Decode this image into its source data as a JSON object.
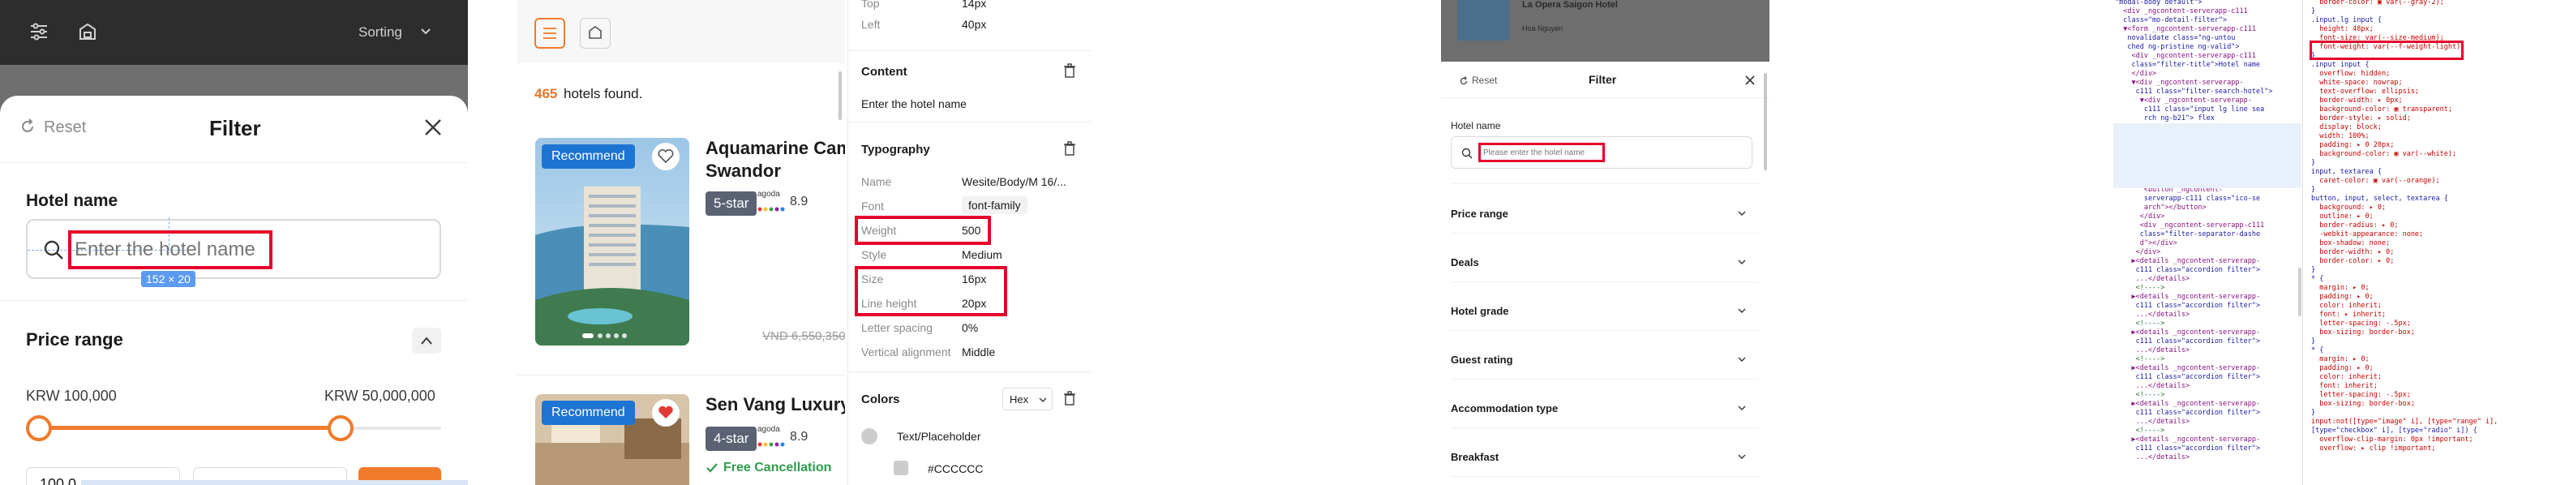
{
  "panel1": {
    "sorting_label": "Sorting",
    "reset_label": "Reset",
    "title": "Filter",
    "hotel_name_label": "Hotel name",
    "hotel_name_placeholder": "Enter the hotel name",
    "dimension_tag": "152 × 20",
    "price_range_label": "Price range",
    "price_min": "KRW 100,000",
    "price_max": "KRW 50,000,000",
    "min_input_partial": "100,0"
  },
  "panel2": {
    "count": "465",
    "count_suffix": "hotels found.",
    "hotels": [
      {
        "badge": "Recommend",
        "name_line1": "Aquamarine Cam",
        "name_line2": "Swandor",
        "stars": "5-star",
        "agoda": "agoda",
        "rating": "8.9",
        "old_price": "VND 6,550,350",
        "new_price_partial": "VI",
        "favorited": false
      },
      {
        "badge": "Recommend",
        "name_line1": "Sen Vang Luxury I",
        "stars": "4-star",
        "agoda": "agoda",
        "rating": "8.9",
        "cancellation": "Free Cancellation",
        "favorited": true
      }
    ]
  },
  "panel3": {
    "top_label": "Top",
    "top_value": "14px",
    "left_label": "Left",
    "left_value": "40px",
    "content_header": "Content",
    "content_text": "Enter the hotel name",
    "typography_header": "Typography",
    "rows": [
      {
        "label": "Name",
        "value": "Wesite/Body/M 16/..."
      },
      {
        "label": "Font",
        "value": "font-family"
      },
      {
        "label": "Weight",
        "value": "500"
      },
      {
        "label": "Style",
        "value": "Medium"
      },
      {
        "label": "Size",
        "value": "16px"
      },
      {
        "label": "Line height",
        "value": "20px"
      },
      {
        "label": "Letter spacing",
        "value": "0%"
      },
      {
        "label": "Vertical alignment",
        "value": "Middle"
      }
    ],
    "colors_header": "Colors",
    "color_format": "Hex",
    "color_token": "Text/Placeholder",
    "color_hex": "#CCCCCC"
  },
  "panel4": {
    "card_title_partial": "La Opera Saigon Hotel",
    "card_sub": "Hoa Nguyen",
    "reset_label": "Reset",
    "title": "Filter",
    "hotel_name_label": "Hotel name",
    "hotel_name_placeholder": "Please enter the hotel name",
    "accordions": [
      "Price range",
      "Deals",
      "Hotel grade",
      "Guest rating",
      "Accommodation type",
      "Breakfast"
    ]
  },
  "panel5": {
    "lines_left": [
      "\"modal-body default\">",
      "  <div _ngcontent-serverapp-c111",
      "  class=\"mo-detail-filter\">",
      "  ▼<form _ngcontent-serverapp-c111",
      "   novalidate class=\"ng-untou",
      "   ched ng-pristine ng-valid\">",
      "    <div _ngcontent-serverapp-c111",
      "    class=\"filter-title\">Hotel name",
      "    </div>",
      "    ▼<div _ngcontent-serverapp-",
      "     c111 class=\"filter-search-hotel\">",
      "      ▼<div _ngcontent-serverapp-",
      "       c111 class=\"input lg line sea",
      "       rch ng-b21\"> flex",
      "       <input _ngcontent-serverapp-",
      "       c111 type=\"text\"",
      "       autocomplete=\"off\"",
      "       placeholder=\"Please enter th",
      "       e hotel name\" class=\"ng-unto",
      "       uched ng-pristine ng-vali",
      "       d\"> == $0",
      "       <button _ngcontent-",
      "       serverapp-c111 class=\"ico-se",
      "       arch\"></button>",
      "      </div>",
      "      <div _ngcontent-serverapp-c111",
      "      class=\"filter-separator-dashe",
      "      d\"></div>",
      "     </div>",
      "    ▶<details _ngcontent-serverapp-",
      "     c111 class=\"accordion filter\">",
      "     ...</details>",
      "     <!---->",
      "    ▶<details _ngcontent-serverapp-",
      "     c111 class=\"accordion filter\">",
      "     ...</details>",
      "     <!---->",
      "    ▶<details _ngcontent-serverapp-",
      "     c111 class=\"accordion filter\">",
      "     ...</details>",
      "     <!---->",
      "    ▶<details _ngcontent-serverapp-",
      "     c111 class=\"accordion filter\">",
      "     ...</details>",
      "     <!---->",
      "    ▶<details _ngcontent-serverapp-",
      "     c111 class=\"accordion filter\">",
      "     ...</details>",
      "     <!---->",
      "    ▶<details _ngcontent-serverapp-",
      "     c111 class=\"accordion filter\">",
      "     ...</details>"
    ],
    "lines_right": [
      "  border-color: ▣ var(--gray-2);",
      "}",
      "",
      ".input.lg input {",
      "  height: 48px;",
      "  font-size: var(--size-medium);",
      "  font-weight: var(--f-weight-light);",
      "}",
      ".input input {",
      "  overflow: hidden;",
      "  white-space: nowrap;",
      "  text-overflow: ellipsis;",
      "  border-width: ▸ 0px;",
      "  background-color: ▣ transparent;",
      "  border-style: ▸ solid;",
      "  display: block;",
      "  width: 100%;",
      "  padding: ▸ 0 20px;",
      "  background-color: ▣ var(--white);",
      "}",
      "",
      "input, textarea {",
      "  caret-color: ▣ var(--orange);",
      "}",
      "",
      "button, input, select, textarea {",
      "  background: ▸ 0;",
      "  outline: ▸ 0;",
      "  border-radius: ▸ 0;",
      "  -webkit-appearance: none;",
      "  box-shadow: none;",
      "  border-width: ▸ 0;",
      "  border-color: ▸ 0;",
      "}",
      "* {",
      "  margin: ▸ 0;",
      "  padding: ▸ 0;",
      "  color: inherit;",
      "  font: ▸ inherit;",
      "  letter-spacing: -.5px;",
      "  box-sizing: border-box;",
      "}",
      "* {",
      "  margin: ▸ 0;",
      "  padding: ▸ 0;",
      "  color: inherit;",
      "  font: inherit;",
      "  letter-spacing: -.5px;",
      "  box-sizing: border-box;",
      "}",
      "input:not([type=\"image\" i], [type=\"range\" i],",
      "[type=\"checkbox\" i], [type=\"radio\" i]) {",
      "  overflow-clip-margin: 0px !important;",
      "  overflow: ▸ clip !important;"
    ]
  },
  "colors": {
    "accent_orange": "#f07b2c",
    "highlight_red": "#e4002b",
    "recommend_blue": "#1e74d3",
    "count_orange": "#e8762c"
  }
}
